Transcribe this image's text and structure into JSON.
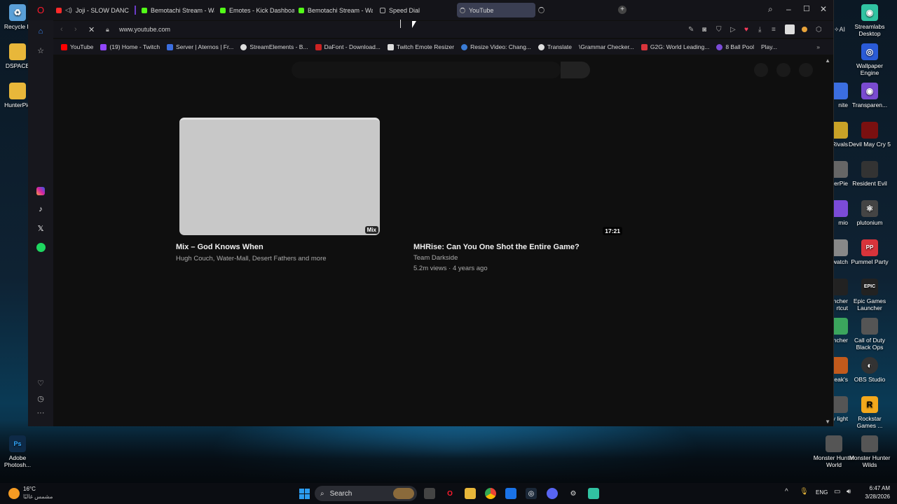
{
  "desktop": {
    "left_icons": [
      {
        "label": "Recycle B",
        "icon": "recycle-bin-icon",
        "color": "#5aa0d8"
      },
      {
        "label": "DSPACE",
        "icon": "folder-icon",
        "color": "#e8b73a"
      },
      {
        "label": "HunterPie",
        "icon": "folder-icon",
        "color": "#e8b73a"
      },
      {
        "label": "Adobe Photosh...",
        "icon": "photoshop-icon",
        "color": "#31a8ff"
      }
    ],
    "right_icons": [
      {
        "label": "Streamlabs Desktop",
        "icon": "streamlabs-icon",
        "color": "#31c3a2"
      },
      {
        "label": "Wallpaper Engine",
        "icon": "wallpaper-engine-icon",
        "color": "#2a5bd7"
      },
      {
        "label": "Transparen...",
        "icon": "transparent-icon",
        "color": "#7a4bd1"
      },
      {
        "label": "Devil May Cry 5",
        "icon": "dmc-icon",
        "color": "#7a1010"
      },
      {
        "label": "Resident Evil",
        "icon": "resident-evil-icon",
        "color": "#333"
      },
      {
        "label": "plutonium",
        "icon": "atom-icon",
        "color": "#444"
      },
      {
        "label": "Pummel Party",
        "icon": "pummel-party-icon",
        "color": "#d8343b"
      },
      {
        "label": "Epic Games Launcher",
        "icon": "epic-games-icon",
        "color": "#222"
      },
      {
        "label": "Call of Duty Black Ops",
        "icon": "cod-icon",
        "color": "#555"
      },
      {
        "label": "OBS Studio",
        "icon": "obs-icon",
        "color": "#333"
      },
      {
        "label": "Rockstar Games ...",
        "icon": "rockstar-icon",
        "color": "#f3a81c"
      },
      {
        "label": "Monster Hunter World",
        "icon": "mhw-icon",
        "color": "#555"
      },
      {
        "label": "Monster Hunter Wilds",
        "icon": "mhwilds-icon",
        "color": "#555"
      }
    ],
    "partial_icons": [
      "nite",
      "l Rivals",
      "erPie",
      "mio",
      "watch",
      "uncher rtcut",
      "ncher",
      "eak's",
      "d by light"
    ]
  },
  "browser": {
    "tabs": [
      {
        "label": "Joji - SLOW DANCING",
        "color": "#ff2a2a"
      },
      {
        "label": "Bemotachi Stream - Watc",
        "color": "#53fc18"
      },
      {
        "label": "Emotes - Kick Dashboard",
        "color": "#53fc18"
      },
      {
        "label": "Bemotachi Stream - Watc",
        "color": "#53fc18"
      },
      {
        "label": "Speed Dial",
        "color": "#aaaaaa"
      },
      {
        "label": "YouTube",
        "color": "#888888"
      }
    ],
    "address": "www.youtube.com",
    "ai_label": "AI",
    "bookmarks": [
      {
        "label": "YouTube",
        "color": "#ff0000"
      },
      {
        "label": "(19) Home - Twitch",
        "color": "#9146ff"
      },
      {
        "label": "Server | Aternos | Fr...",
        "color": "#3b6ee0"
      },
      {
        "label": "StreamElements - B...",
        "color": "#dddddd"
      },
      {
        "label": "DaFont - Download...",
        "color": "#cc2222"
      },
      {
        "label": "Twitch Emote Resizer",
        "color": "#dddddd"
      },
      {
        "label": "Resize Video: Chang...",
        "color": "#3a7bd5"
      },
      {
        "label": "Translate",
        "color": "#dddddd"
      },
      {
        "label": "\\Grammar Checker...",
        "color": "#15c39a"
      },
      {
        "label": "G2G: World Leading...",
        "color": "#d8343b"
      },
      {
        "label": "8 Ball Pool",
        "color": "#7b4bd8"
      },
      {
        "label": "Play...",
        "color": "#dddddd"
      }
    ]
  },
  "youtube": {
    "videos": [
      {
        "title": "Mix – God Knows When",
        "sub": "Hugh Couch, Water-Mall, Desert Fathers and more",
        "badge": "Mix"
      },
      {
        "title": "MHRise: Can You One Shot the Entire Game?",
        "channel": "Team Darkside",
        "meta": "5.2m views · 4 years ago",
        "duration": "17:21"
      }
    ]
  },
  "taskbar": {
    "weather_temp": "16°C",
    "weather_desc": "مشمس غالبًا",
    "search_label": "Search",
    "lang": "ENG",
    "time": "6:47 AM",
    "date": "3/28/2026"
  }
}
